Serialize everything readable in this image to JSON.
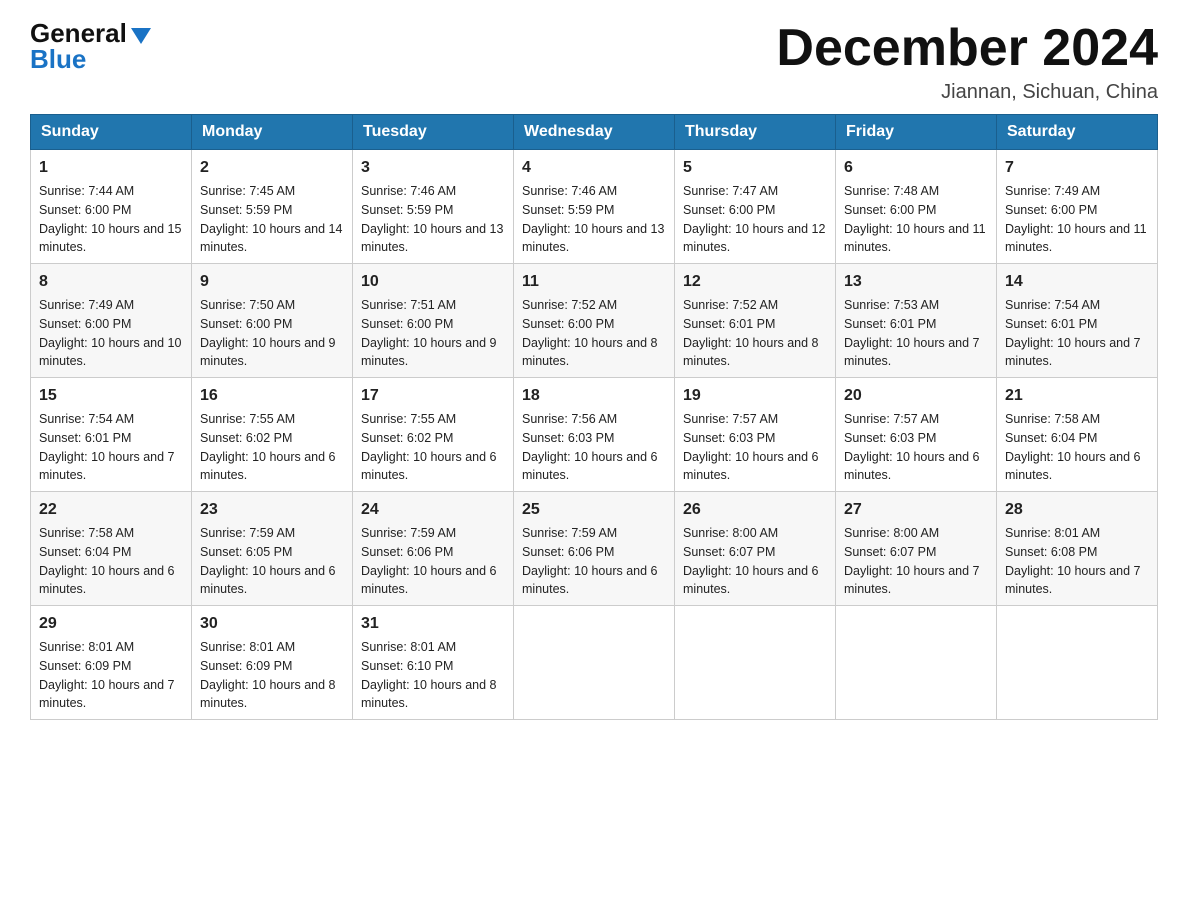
{
  "header": {
    "title": "December 2024",
    "location": "Jiannan, Sichuan, China",
    "logo_general": "General",
    "logo_blue": "Blue"
  },
  "days_of_week": [
    "Sunday",
    "Monday",
    "Tuesday",
    "Wednesday",
    "Thursday",
    "Friday",
    "Saturday"
  ],
  "weeks": [
    [
      {
        "num": "1",
        "sunrise": "7:44 AM",
        "sunset": "6:00 PM",
        "daylight": "10 hours and 15 minutes."
      },
      {
        "num": "2",
        "sunrise": "7:45 AM",
        "sunset": "5:59 PM",
        "daylight": "10 hours and 14 minutes."
      },
      {
        "num": "3",
        "sunrise": "7:46 AM",
        "sunset": "5:59 PM",
        "daylight": "10 hours and 13 minutes."
      },
      {
        "num": "4",
        "sunrise": "7:46 AM",
        "sunset": "5:59 PM",
        "daylight": "10 hours and 13 minutes."
      },
      {
        "num": "5",
        "sunrise": "7:47 AM",
        "sunset": "6:00 PM",
        "daylight": "10 hours and 12 minutes."
      },
      {
        "num": "6",
        "sunrise": "7:48 AM",
        "sunset": "6:00 PM",
        "daylight": "10 hours and 11 minutes."
      },
      {
        "num": "7",
        "sunrise": "7:49 AM",
        "sunset": "6:00 PM",
        "daylight": "10 hours and 11 minutes."
      }
    ],
    [
      {
        "num": "8",
        "sunrise": "7:49 AM",
        "sunset": "6:00 PM",
        "daylight": "10 hours and 10 minutes."
      },
      {
        "num": "9",
        "sunrise": "7:50 AM",
        "sunset": "6:00 PM",
        "daylight": "10 hours and 9 minutes."
      },
      {
        "num": "10",
        "sunrise": "7:51 AM",
        "sunset": "6:00 PM",
        "daylight": "10 hours and 9 minutes."
      },
      {
        "num": "11",
        "sunrise": "7:52 AM",
        "sunset": "6:00 PM",
        "daylight": "10 hours and 8 minutes."
      },
      {
        "num": "12",
        "sunrise": "7:52 AM",
        "sunset": "6:01 PM",
        "daylight": "10 hours and 8 minutes."
      },
      {
        "num": "13",
        "sunrise": "7:53 AM",
        "sunset": "6:01 PM",
        "daylight": "10 hours and 7 minutes."
      },
      {
        "num": "14",
        "sunrise": "7:54 AM",
        "sunset": "6:01 PM",
        "daylight": "10 hours and 7 minutes."
      }
    ],
    [
      {
        "num": "15",
        "sunrise": "7:54 AM",
        "sunset": "6:01 PM",
        "daylight": "10 hours and 7 minutes."
      },
      {
        "num": "16",
        "sunrise": "7:55 AM",
        "sunset": "6:02 PM",
        "daylight": "10 hours and 6 minutes."
      },
      {
        "num": "17",
        "sunrise": "7:55 AM",
        "sunset": "6:02 PM",
        "daylight": "10 hours and 6 minutes."
      },
      {
        "num": "18",
        "sunrise": "7:56 AM",
        "sunset": "6:03 PM",
        "daylight": "10 hours and 6 minutes."
      },
      {
        "num": "19",
        "sunrise": "7:57 AM",
        "sunset": "6:03 PM",
        "daylight": "10 hours and 6 minutes."
      },
      {
        "num": "20",
        "sunrise": "7:57 AM",
        "sunset": "6:03 PM",
        "daylight": "10 hours and 6 minutes."
      },
      {
        "num": "21",
        "sunrise": "7:58 AM",
        "sunset": "6:04 PM",
        "daylight": "10 hours and 6 minutes."
      }
    ],
    [
      {
        "num": "22",
        "sunrise": "7:58 AM",
        "sunset": "6:04 PM",
        "daylight": "10 hours and 6 minutes."
      },
      {
        "num": "23",
        "sunrise": "7:59 AM",
        "sunset": "6:05 PM",
        "daylight": "10 hours and 6 minutes."
      },
      {
        "num": "24",
        "sunrise": "7:59 AM",
        "sunset": "6:06 PM",
        "daylight": "10 hours and 6 minutes."
      },
      {
        "num": "25",
        "sunrise": "7:59 AM",
        "sunset": "6:06 PM",
        "daylight": "10 hours and 6 minutes."
      },
      {
        "num": "26",
        "sunrise": "8:00 AM",
        "sunset": "6:07 PM",
        "daylight": "10 hours and 6 minutes."
      },
      {
        "num": "27",
        "sunrise": "8:00 AM",
        "sunset": "6:07 PM",
        "daylight": "10 hours and 7 minutes."
      },
      {
        "num": "28",
        "sunrise": "8:01 AM",
        "sunset": "6:08 PM",
        "daylight": "10 hours and 7 minutes."
      }
    ],
    [
      {
        "num": "29",
        "sunrise": "8:01 AM",
        "sunset": "6:09 PM",
        "daylight": "10 hours and 7 minutes."
      },
      {
        "num": "30",
        "sunrise": "8:01 AM",
        "sunset": "6:09 PM",
        "daylight": "10 hours and 8 minutes."
      },
      {
        "num": "31",
        "sunrise": "8:01 AM",
        "sunset": "6:10 PM",
        "daylight": "10 hours and 8 minutes."
      },
      null,
      null,
      null,
      null
    ]
  ]
}
